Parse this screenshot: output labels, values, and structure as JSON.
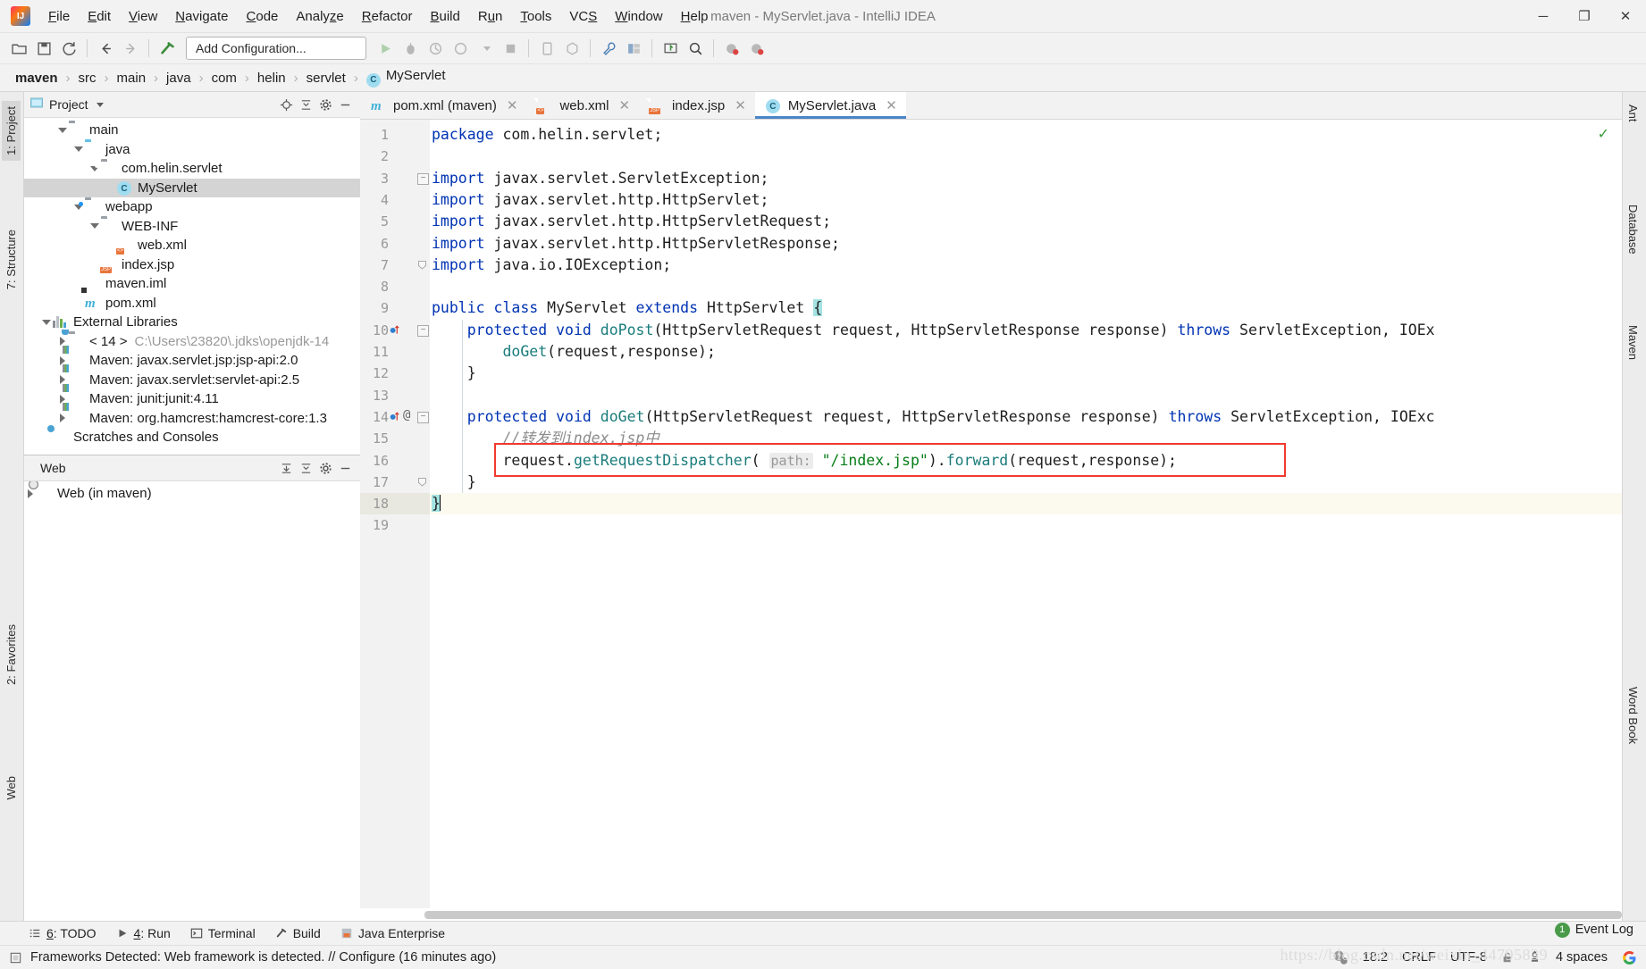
{
  "window": {
    "title": "maven - MyServlet.java - IntelliJ IDEA",
    "minimize": "─",
    "maximize": "❐",
    "close": "✕"
  },
  "menu": [
    {
      "label": "File",
      "mnemonic": "F"
    },
    {
      "label": "Edit",
      "mnemonic": "E"
    },
    {
      "label": "View",
      "mnemonic": "V"
    },
    {
      "label": "Navigate",
      "mnemonic": "N"
    },
    {
      "label": "Code",
      "mnemonic": "C"
    },
    {
      "label": "Analyze",
      "mnemonic": "z"
    },
    {
      "label": "Refactor",
      "mnemonic": "R"
    },
    {
      "label": "Build",
      "mnemonic": "B"
    },
    {
      "label": "Run",
      "mnemonic": "u"
    },
    {
      "label": "Tools",
      "mnemonic": "T"
    },
    {
      "label": "VCS",
      "mnemonic": "S"
    },
    {
      "label": "Window",
      "mnemonic": "W"
    },
    {
      "label": "Help",
      "mnemonic": "H"
    }
  ],
  "toolbar": {
    "run_config": "Add Configuration...",
    "icons": [
      "open-folder-icon",
      "save-all-icon",
      "sync-refresh-icon",
      "back-arrow-icon",
      "forward-arrow-icon",
      "hammer-build-icon",
      "run-icon",
      "debug-icon",
      "run-coverage-icon",
      "profile-icon",
      "stop-icon",
      "device-manager-icon",
      "sdk-manager-icon",
      "settings-wrench-icon",
      "project-structure-icon",
      "update-app-icon",
      "search-everywhere-icon",
      "ide-help-icon",
      "feedback-icon"
    ]
  },
  "breadcrumb": [
    {
      "label": "maven",
      "bold": true
    },
    {
      "label": "src",
      "bold": false
    },
    {
      "label": "main",
      "bold": false
    },
    {
      "label": "java",
      "bold": false
    },
    {
      "label": "com",
      "bold": false
    },
    {
      "label": "helin",
      "bold": false
    },
    {
      "label": "servlet",
      "bold": false
    },
    {
      "label": "MyServlet",
      "bold": false,
      "icon": "java-class-icon"
    }
  ],
  "left_strip": [
    {
      "label": "1: Project",
      "selected": true
    },
    {
      "label": "7: Structure",
      "selected": false
    },
    {
      "label": "2: Favorites",
      "selected": false
    },
    {
      "label": "Web",
      "selected": false
    }
  ],
  "right_strip": [
    {
      "label": "Ant"
    },
    {
      "label": "Database"
    },
    {
      "label": "Maven"
    },
    {
      "label": "Word Book"
    }
  ],
  "project_panel": {
    "title": "Project",
    "header_icons": [
      "locate-target-icon",
      "collapse-all-icon",
      "settings-gear-icon",
      "hide-minus-icon"
    ],
    "tree": [
      {
        "label": "main",
        "indent": 3,
        "arrow": "down",
        "icon": "folder-icon",
        "selected": false
      },
      {
        "label": "java",
        "indent": 4,
        "arrow": "down",
        "icon": "source-folder-icon",
        "selected": false
      },
      {
        "label": "com.helin.servlet",
        "indent": 5,
        "arrow": "down",
        "icon": "package-icon",
        "selected": false
      },
      {
        "label": "MyServlet",
        "indent": 6,
        "arrow": "none",
        "icon": "java-class-icon",
        "selected": true
      },
      {
        "label": "webapp",
        "indent": 4,
        "arrow": "down",
        "icon": "web-folder-icon",
        "selected": false
      },
      {
        "label": "WEB-INF",
        "indent": 5,
        "arrow": "down",
        "icon": "folder-icon",
        "selected": false
      },
      {
        "label": "web.xml",
        "indent": 6,
        "arrow": "none",
        "icon": "xml-file-icon",
        "selected": false
      },
      {
        "label": "index.jsp",
        "indent": 5,
        "arrow": "none",
        "icon": "jsp-file-icon",
        "selected": false
      },
      {
        "label": "maven.iml",
        "indent": 4,
        "arrow": "none",
        "icon": "iml-file-icon",
        "selected": false
      },
      {
        "label": "pom.xml",
        "indent": 4,
        "arrow": "none",
        "icon": "maven-pom-icon",
        "selected": false
      },
      {
        "label": "External Libraries",
        "indent": 2,
        "arrow": "down",
        "icon": "libraries-icon",
        "selected": false
      },
      {
        "label": "< 14 >",
        "indent": 3,
        "arrow": "right",
        "icon": "jdk-folder-icon",
        "selected": false,
        "sublabel": "C:\\Users\\23820\\.jdks\\openjdk-14"
      },
      {
        "label": "Maven: javax.servlet.jsp:jsp-api:2.0",
        "indent": 3,
        "arrow": "right",
        "icon": "jar-icon",
        "selected": false
      },
      {
        "label": "Maven: javax.servlet:servlet-api:2.5",
        "indent": 3,
        "arrow": "right",
        "icon": "jar-icon",
        "selected": false
      },
      {
        "label": "Maven: junit:junit:4.11",
        "indent": 3,
        "arrow": "right",
        "icon": "jar-icon",
        "selected": false
      },
      {
        "label": "Maven: org.hamcrest:hamcrest-core:1.3",
        "indent": 3,
        "arrow": "right",
        "icon": "jar-icon",
        "selected": false
      },
      {
        "label": "Scratches and Consoles",
        "indent": 2,
        "arrow": "none",
        "icon": "scratches-icon",
        "selected": false
      }
    ]
  },
  "web_panel": {
    "title": "Web",
    "header_icons": [
      "expand-all-icon",
      "collapse-all-icon",
      "settings-gear-icon",
      "hide-minus-icon"
    ],
    "tree": [
      {
        "label": "Web (in maven)",
        "indent": 1,
        "arrow": "right",
        "icon": "web-facet-icon",
        "selected": false
      }
    ]
  },
  "editor_tabs": [
    {
      "label": "pom.xml (maven)",
      "icon": "maven-pom-icon",
      "active": false
    },
    {
      "label": "web.xml",
      "icon": "xml-file-icon",
      "active": false
    },
    {
      "label": "index.jsp",
      "icon": "jsp-file-icon",
      "active": false
    },
    {
      "label": "MyServlet.java",
      "icon": "java-class-icon",
      "active": true
    }
  ],
  "editor": {
    "filename": "MyServlet.java",
    "inspection_status": "ok",
    "lines": [
      {
        "n": 1,
        "text": "package com.helin.servlet;"
      },
      {
        "n": 2,
        "text": ""
      },
      {
        "n": 3,
        "text": "import javax.servlet.ServletException;"
      },
      {
        "n": 4,
        "text": "import javax.servlet.http.HttpServlet;"
      },
      {
        "n": 5,
        "text": "import javax.servlet.http.HttpServletRequest;"
      },
      {
        "n": 6,
        "text": "import javax.servlet.http.HttpServletResponse;"
      },
      {
        "n": 7,
        "text": "import java.io.IOException;"
      },
      {
        "n": 8,
        "text": ""
      },
      {
        "n": 9,
        "text": "public class MyServlet extends HttpServlet {"
      },
      {
        "n": 10,
        "text": "    protected void doPost(HttpServletRequest request, HttpServletResponse response) throws ServletException, IOEx"
      },
      {
        "n": 11,
        "text": "        doGet(request,response);"
      },
      {
        "n": 12,
        "text": "    }"
      },
      {
        "n": 13,
        "text": ""
      },
      {
        "n": 14,
        "text": "    protected void doGet(HttpServletRequest request, HttpServletResponse response) throws ServletException, IOExc"
      },
      {
        "n": 15,
        "text": "        //转发到index.jsp中"
      },
      {
        "n": 16,
        "text": "        request.getRequestDispatcher( path: \"/index.jsp\").forward(request,response);"
      },
      {
        "n": 17,
        "text": "    }"
      },
      {
        "n": 18,
        "text": "}"
      },
      {
        "n": 19,
        "text": ""
      }
    ],
    "param_hint": "path:",
    "gutter_marks": [
      {
        "line": 10,
        "icon": "override-method-icon",
        "extra": ""
      },
      {
        "line": 14,
        "icon": "override-method-icon",
        "extra": "@"
      }
    ],
    "highlight_box_line": 16,
    "highlight_box_color": "#f03a2e",
    "current_line": 18,
    "caret_position": "18:2"
  },
  "bottom_tools": [
    {
      "label": "6: TODO",
      "mnemonic": "6",
      "icon": "todo-list-icon"
    },
    {
      "label": "4: Run",
      "mnemonic": "4",
      "icon": "run-play-icon"
    },
    {
      "label": "Terminal",
      "mnemonic": "",
      "icon": "terminal-icon"
    },
    {
      "label": "Build",
      "mnemonic": "",
      "icon": "build-hammer-icon"
    },
    {
      "label": "Java Enterprise",
      "mnemonic": "",
      "icon": "java-enterprise-icon"
    }
  ],
  "status_bar": {
    "message_icon": "frameworks-detected-icon",
    "message": "Frameworks Detected: Web framework is detected. // Configure (16 minutes ago)",
    "event_log_label": "Event Log",
    "event_log_count": "1",
    "caret": "18:2",
    "line_separator": "CRLF",
    "encoding": "UTF-8",
    "lock_icon": "unlocked-icon",
    "git_branch_icon": "no-branch-icon",
    "indent": "4 spaces",
    "inspection_icon": "inspections-icon",
    "google_icon": "google-translate-icon",
    "watermark": "https://blog.csdn.net/weixin_44795839"
  },
  "colors": {
    "accent": "#4a86c8",
    "keyword": "#0033b3",
    "string": "#067d17",
    "comment": "#8c8c8c",
    "method": "#1a7b7b",
    "highlight_box": "#f03a2e",
    "selection": "#d4d4d4",
    "current_line": "#fcfaef",
    "brace_match": "#a5e3e3"
  }
}
